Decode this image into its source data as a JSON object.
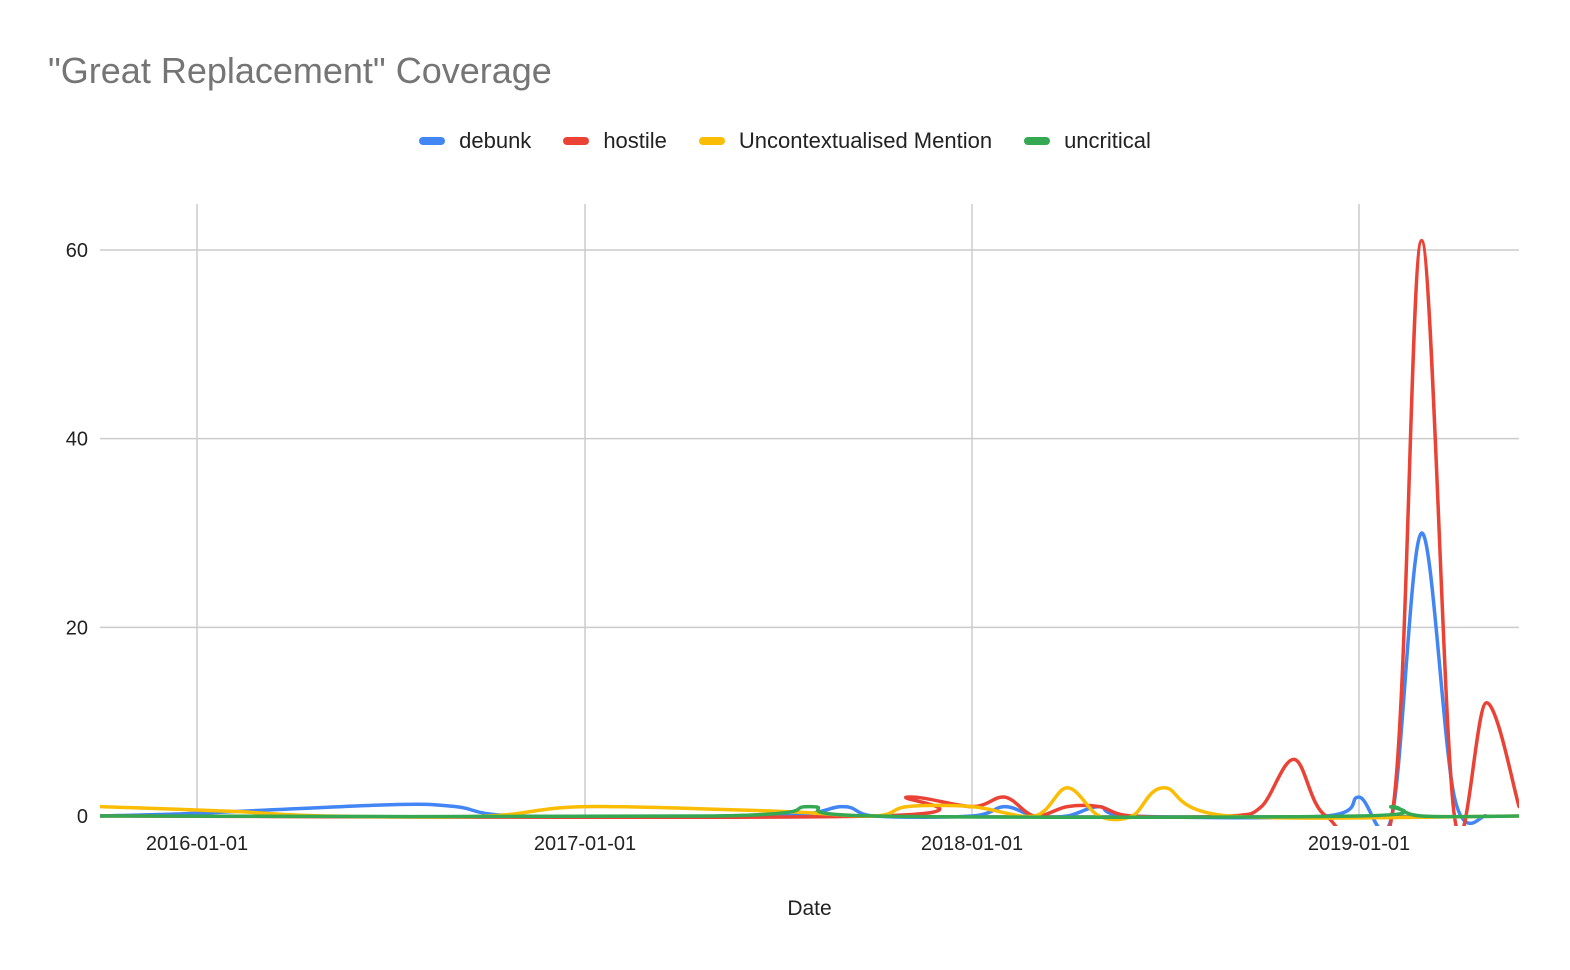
{
  "chart_data": {
    "type": "line",
    "title": "\"Great Replacement\" Coverage",
    "xlabel": "Date",
    "ylabel": "",
    "xlim": [
      "2015-10-01",
      "2019-05-01"
    ],
    "ylim": [
      0,
      65
    ],
    "y_ticks": [
      0,
      20,
      40,
      60
    ],
    "x_ticks": [
      "2016-01-01",
      "2017-01-01",
      "2018-01-01",
      "2019-01-01"
    ],
    "grid": true,
    "legend": "top-center",
    "series": [
      {
        "name": "debunk",
        "color": "#4285F4",
        "points": [
          [
            "2015-10-01",
            0
          ],
          [
            "2016-01-01",
            0.3
          ],
          [
            "2016-07-01",
            1.2
          ],
          [
            "2016-09-01",
            1.0
          ],
          [
            "2016-11-01",
            0
          ],
          [
            "2017-07-01",
            0
          ],
          [
            "2017-09-01",
            1.0
          ],
          [
            "2017-10-01",
            0
          ],
          [
            "2018-01-01",
            0
          ],
          [
            "2018-02-01",
            1.0
          ],
          [
            "2018-03-01",
            0
          ],
          [
            "2018-04-01",
            0
          ],
          [
            "2018-05-01",
            1.0
          ],
          [
            "2018-06-01",
            0
          ],
          [
            "2018-12-01",
            0
          ],
          [
            "2019-01-01",
            2.0
          ],
          [
            "2019-02-01",
            0
          ],
          [
            "2019-03-01",
            30.0
          ],
          [
            "2019-04-01",
            2.0
          ],
          [
            "2019-05-01",
            0
          ]
        ]
      },
      {
        "name": "hostile",
        "color": "#EA4335",
        "points": [
          [
            "2015-10-01",
            0
          ],
          [
            "2017-10-01",
            0
          ],
          [
            "2017-11-01",
            2.0
          ],
          [
            "2018-01-01",
            1.0
          ],
          [
            "2018-02-01",
            2.0
          ],
          [
            "2018-03-01",
            0
          ],
          [
            "2018-04-01",
            1.0
          ],
          [
            "2018-05-01",
            1.0
          ],
          [
            "2018-06-01",
            0
          ],
          [
            "2018-09-01",
            0
          ],
          [
            "2018-10-01",
            1.0
          ],
          [
            "2018-11-01",
            6.0
          ],
          [
            "2018-12-01",
            0
          ],
          [
            "2019-02-01",
            0
          ],
          [
            "2019-03-01",
            61.0
          ],
          [
            "2019-04-01",
            0
          ],
          [
            "2019-05-01",
            12.0
          ],
          [
            "2019-06-01",
            1.0
          ]
        ]
      },
      {
        "name": "Uncontextualised Mention",
        "color": "#FBBC04",
        "points": [
          [
            "2015-10-01",
            1.0
          ],
          [
            "2016-02-01",
            0.5
          ],
          [
            "2016-05-01",
            0
          ],
          [
            "2016-10-01",
            0
          ],
          [
            "2017-01-01",
            1.0
          ],
          [
            "2017-07-01",
            0.5
          ],
          [
            "2017-10-01",
            0
          ],
          [
            "2017-11-01",
            1.0
          ],
          [
            "2018-01-01",
            1.0
          ],
          [
            "2018-03-01",
            0
          ],
          [
            "2018-04-01",
            3.0
          ],
          [
            "2018-05-01",
            0
          ],
          [
            "2018-06-01",
            0
          ],
          [
            "2018-07-01",
            3.0
          ],
          [
            "2018-09-01",
            0
          ],
          [
            "2019-06-01",
            0
          ]
        ]
      },
      {
        "name": "uncritical",
        "color": "#34A853",
        "points": [
          [
            "2015-10-01",
            0
          ],
          [
            "2017-05-01",
            0
          ],
          [
            "2017-08-01",
            1.0
          ],
          [
            "2017-10-01",
            0
          ],
          [
            "2019-01-01",
            0
          ],
          [
            "2019-02-01",
            1.0
          ],
          [
            "2019-03-01",
            0
          ],
          [
            "2019-06-01",
            0
          ]
        ]
      }
    ]
  }
}
